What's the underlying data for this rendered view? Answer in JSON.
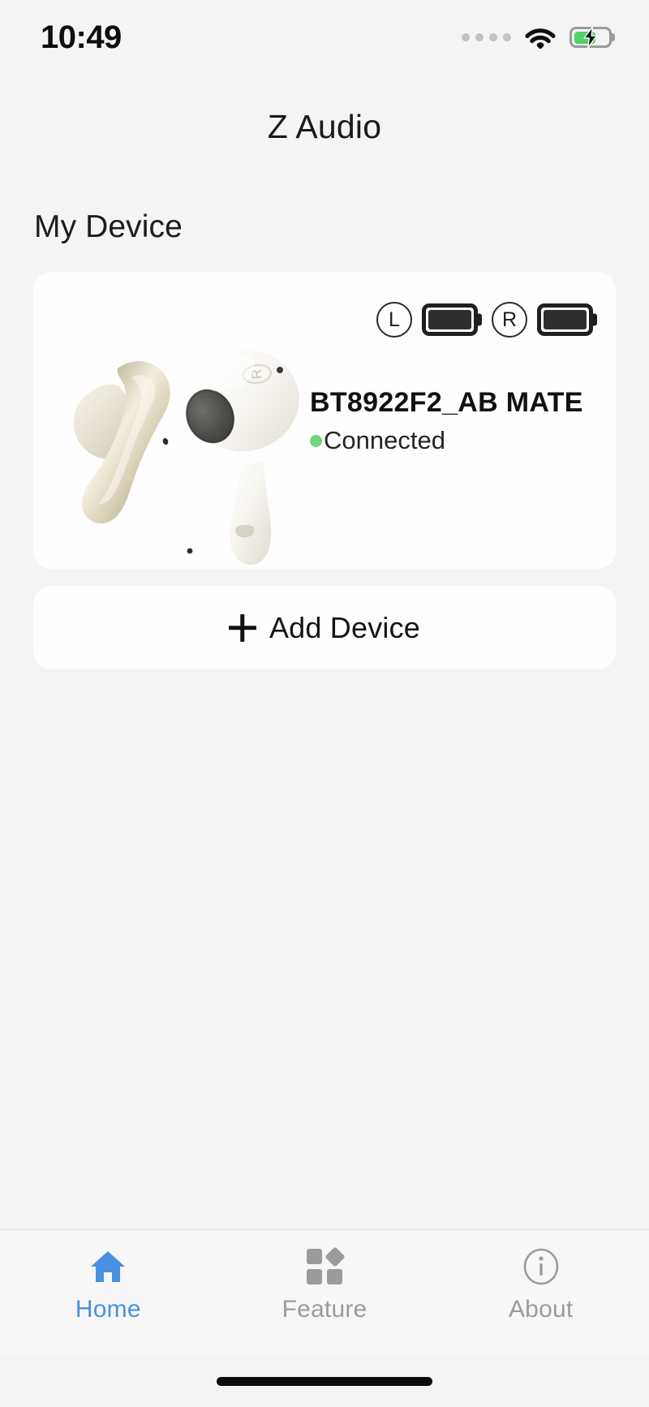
{
  "status_bar": {
    "time": "10:49",
    "signal_dots": 4,
    "wifi_icon": "wifi-icon",
    "battery": {
      "icon": "battery-charging-icon",
      "level_percent": 65,
      "charging": true,
      "fill_color": "#4cd464"
    }
  },
  "header": {
    "title": "Z Audio"
  },
  "main": {
    "section_heading": "My Device",
    "device_card": {
      "product_image": "earbuds-image",
      "name": "BT8922F2_AB MATE",
      "status_text": "Connected",
      "status_color": "#6fd57f",
      "batteries": [
        {
          "side_label": "L",
          "icon": "battery-icon",
          "level_percent": 100
        },
        {
          "side_label": "R",
          "icon": "battery-icon",
          "level_percent": 100
        }
      ]
    },
    "add_device": {
      "icon": "plus-icon",
      "label": "Add Device"
    }
  },
  "tab_bar": {
    "active_color": "#4a90e2",
    "inactive_color": "#9b9b9b",
    "items": [
      {
        "label": "Home",
        "icon": "home-icon",
        "active": true
      },
      {
        "label": "Feature",
        "icon": "grid-icon",
        "active": false
      },
      {
        "label": "About",
        "icon": "info-circle-icon",
        "active": false
      }
    ]
  }
}
